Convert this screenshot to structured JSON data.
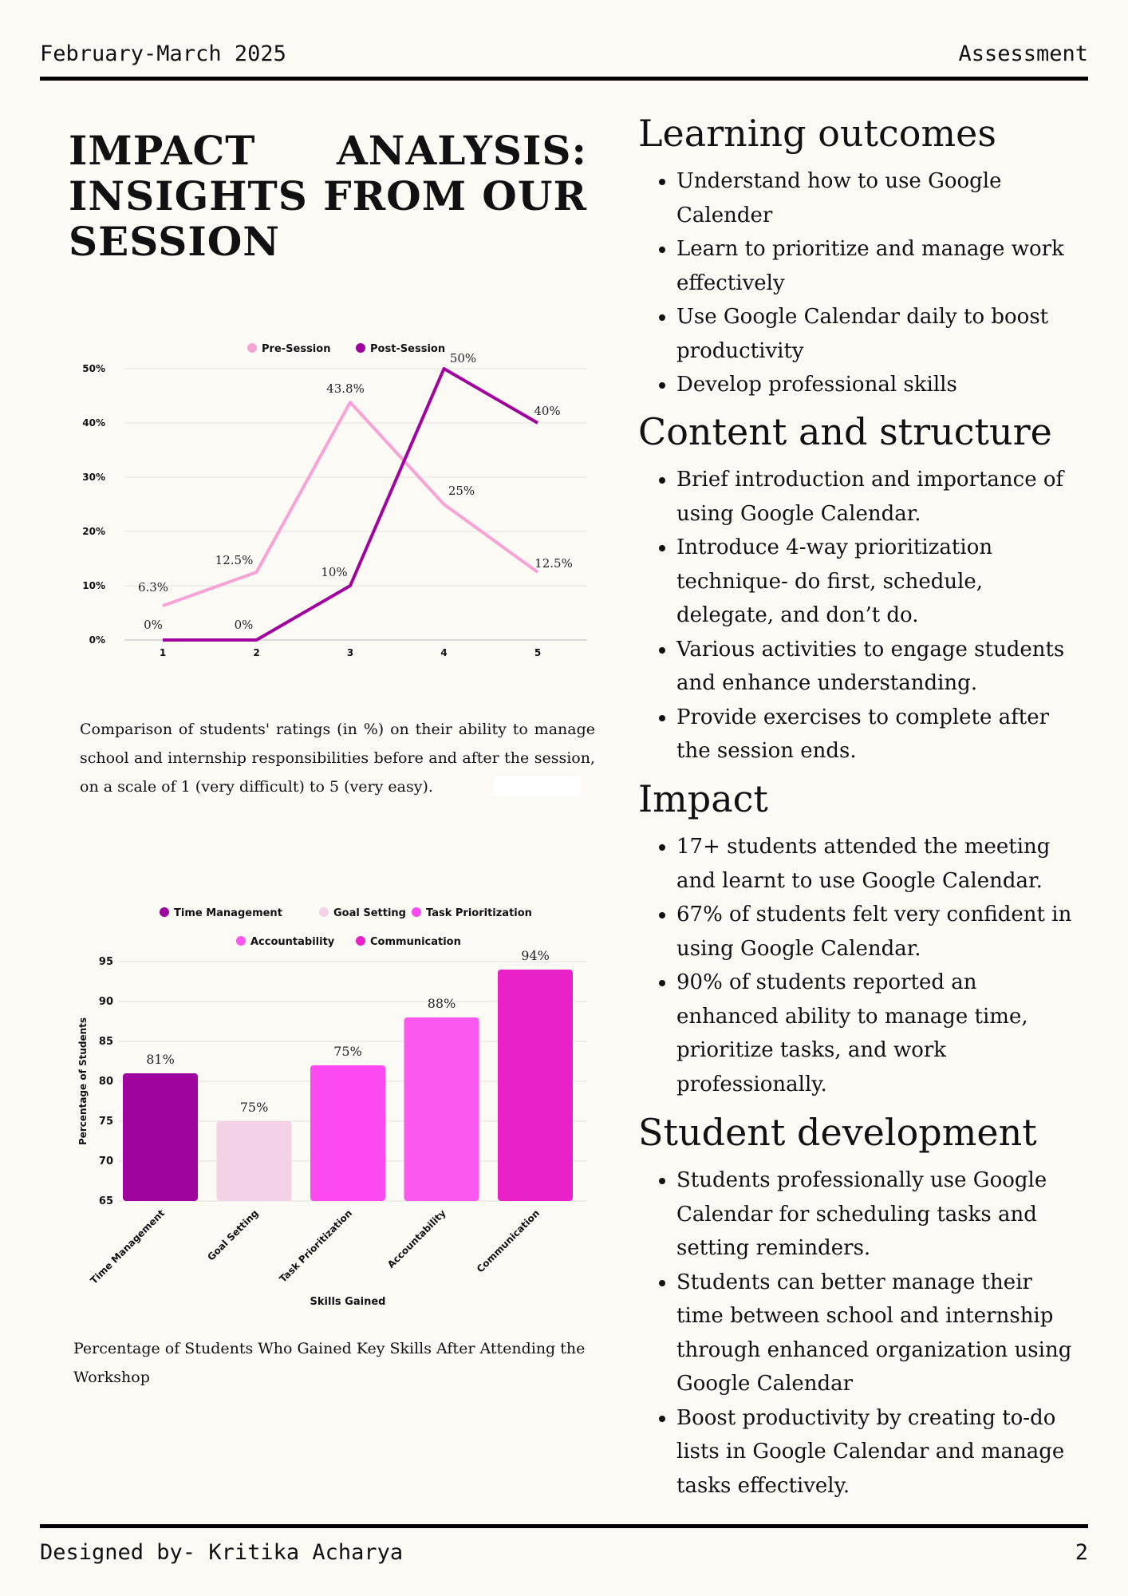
{
  "header": {
    "left": "February-March 2025",
    "right": "Assessment"
  },
  "footer": {
    "left": "Designed by- Kritika Acharya",
    "right": "2"
  },
  "title": "IMPACT ANALYSIS: INSIGHTS FROM OUR SESSION",
  "colors": {
    "pre": "#f7a3d6",
    "post": "#a0049f",
    "time_management": "#a0049f",
    "goal_setting": "#f3d2e8",
    "task_prioritization": "#fc49f0",
    "accountability": "#fb58ef",
    "communication": "#e822c8"
  },
  "chart_data": [
    {
      "type": "line",
      "x": [
        "1",
        "2",
        "3",
        "4",
        "5"
      ],
      "series": [
        {
          "name": "Pre-Session",
          "values": [
            6.3,
            12.5,
            43.8,
            25,
            12.5
          ],
          "labels": [
            "6.3%",
            "12.5%",
            "43.8%",
            "25%",
            "12.5%"
          ],
          "color": "#f7a3d6"
        },
        {
          "name": "Post-Session",
          "values": [
            0,
            0,
            10,
            50,
            40
          ],
          "labels": [
            "0%",
            "0%",
            "10%",
            "50%",
            "40%"
          ],
          "color": "#a0049f"
        }
      ],
      "yticks": [
        "0%",
        "10%",
        "20%",
        "30%",
        "40%",
        "50%"
      ],
      "ylim": [
        0,
        50
      ],
      "grid": true,
      "legend": "top-center",
      "caption": "Comparison of students' ratings (in %) on their ability to manage school and internship responsibilities before and after the session, on a scale of 1 (very difficult) to 5 (very easy)."
    },
    {
      "type": "bar",
      "categories": [
        "Time Management",
        "Goal Setting",
        "Task Prioritization",
        "Accountability",
        "Communication"
      ],
      "values": [
        81,
        75,
        82,
        88,
        94
      ],
      "labels": [
        "81%",
        "75%",
        "75%",
        "88%",
        "94%"
      ],
      "colors": [
        "#a0049f",
        "#f3d2e8",
        "#fc49f0",
        "#fb58ef",
        "#e822c8"
      ],
      "yticks": [
        "65",
        "70",
        "75",
        "80",
        "85",
        "90",
        "95"
      ],
      "ylim": [
        65,
        95
      ],
      "xlabel": "Skills Gained",
      "ylabel": "Percentage of Students",
      "grid": true,
      "legend": "top-center",
      "caption": "Percentage of Students Who Gained Key Skills After Attending the Workshop"
    }
  ],
  "sections": [
    {
      "heading": "Learning outcomes",
      "items": [
        "Understand how to use Google Calender",
        "Learn to prioritize and manage work effectively",
        "Use Google Calendar daily to boost productivity",
        "Develop professional skills"
      ]
    },
    {
      "heading": "Content and structure",
      "items": [
        "Brief introduction and importance of using Google Calendar.",
        "Introduce 4-way prioritization technique- do first, schedule, delegate, and don’t do.",
        "Various activities to engage students and enhance understanding.",
        "Provide exercises to complete after the session ends."
      ]
    },
    {
      "heading": "Impact",
      "items": [
        "17+ students attended the meeting and learnt to use Google Calendar.",
        "67% of students felt very confident in using Google Calendar.",
        "90% of students reported an enhanced ability to manage time, prioritize tasks, and work professionally."
      ]
    },
    {
      "heading": "Student development",
      "items": [
        "Students professionally use Google Calendar for scheduling tasks and setting reminders.",
        "Students can better manage their time between school and internship through enhanced organization using Google Calendar",
        "Boost productivity by creating to-do lists in Google Calendar and manage tasks effectively."
      ]
    }
  ]
}
